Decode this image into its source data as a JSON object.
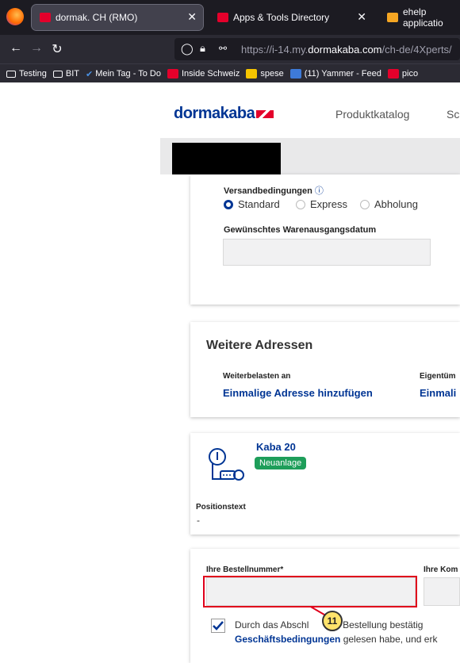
{
  "browser": {
    "tabs": [
      {
        "title": "dormak. CH (RMO)",
        "favicon_color": "#e4002b",
        "active": true
      },
      {
        "title": "Apps & Tools Directory",
        "favicon_color": "#e4002b",
        "active": false
      },
      {
        "title": "ehelp applicatio",
        "favicon_color": "#f5a623",
        "active": false
      }
    ],
    "url_prefix": "https://i-14.my.",
    "url_domain": "dormakaba.com",
    "url_suffix": "/ch-de/4Xperts/",
    "bookmarks": [
      "Testing",
      "BIT",
      "Mein Tag - To Do",
      "Inside Schweiz",
      "spese",
      "(11) Yammer - Feed",
      "pico"
    ]
  },
  "header": {
    "logo": "dormakaba",
    "nav": [
      "Produktkatalog",
      "Sc"
    ]
  },
  "shipping": {
    "label": "Versandbedingungen",
    "options": [
      "Standard",
      "Express",
      "Abholung"
    ],
    "selected": "Standard",
    "date_label": "Gewünschtes Warenausgangsdatum",
    "date_value": ""
  },
  "addresses": {
    "heading": "Weitere Adressen",
    "col1_label": "Weiterbelasten an",
    "col1_link": "Einmalige Adresse hinzufügen",
    "col2_label": "Eigentüm",
    "col2_link": "Einmali"
  },
  "product": {
    "name": "Kaba 20",
    "badge": "Neuanlage",
    "position_label": "Positionstext",
    "position_value": "-"
  },
  "order": {
    "order_number_label": "Ihre Bestellnummer*",
    "order_number_value": "",
    "col2_label": "Ihre Kom",
    "terms_text_1a": "Durch das Abschl",
    "terms_text_1b": "der Bestellung bestätig",
    "terms_link": "Geschäftsbedingungen",
    "terms_text_2": " gelesen habe, und erk",
    "checked": true
  },
  "annotation": {
    "step": "11",
    "color": "#e0001b"
  }
}
